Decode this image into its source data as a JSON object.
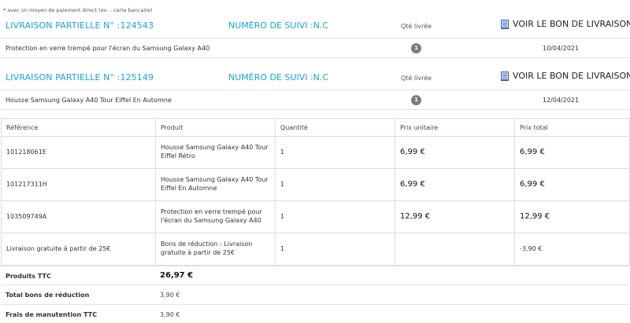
{
  "note": {
    "star": "*",
    "text": "avec un moyen de paiement direct (ex. : carte bancaire)"
  },
  "shipments": [
    {
      "title": "LIVRAISON PARTIELLE N° :124543",
      "tracking": "NUMÉRO DE SUIVI :N.C",
      "qty_header": "Qté livrée",
      "link": "VOIR LE BON DE LIVRAISON",
      "product": "Protection en verre trempé pour l'écran du Samsung Galaxy A40",
      "qty": "1",
      "date": "10/04/2021"
    },
    {
      "title": "LIVRAISON PARTIELLE N° :125149",
      "tracking": "NUMÉRO DE SUIVI :N.C",
      "qty_header": "Qté livrée",
      "link": "VOIR LE BON DE LIVRAISON",
      "product": "Housse Samsung Galaxy A40 Tour Eiffel En Automne",
      "qty": "1",
      "date": "12/04/2021"
    }
  ],
  "table": {
    "headers": [
      "Référence",
      "Produit",
      "Quantité",
      "Prix unitaire",
      "Prix total"
    ],
    "rows": [
      {
        "ref": "101218061E",
        "product": "Housse Samsung Galaxy A40 Tour Eiffel Rétro",
        "qty": "1",
        "unit": "6,99 €",
        "total": "6,99 €"
      },
      {
        "ref": "101217311H",
        "product": "Housse Samsung Galaxy A40 Tour Eiffel En Automne",
        "qty": "1",
        "unit": "6,99 €",
        "total": "6,99 €"
      },
      {
        "ref": "103509749A",
        "product": "Protection en verre trempé pour l'écran du Samsung Galaxy A40",
        "qty": "1",
        "unit": "12,99 €",
        "total": "12,99 €"
      },
      {
        "ref": "Livraison gratuite à partir de 25€",
        "product": "Bons de réduction : Livraison gratuite à partir de 25€",
        "qty": "1",
        "unit": "",
        "total": "-3,90 €"
      }
    ]
  },
  "totals": [
    {
      "label": "Produits TTC",
      "value": "26,97 €"
    },
    {
      "label": "Total bons de réduction",
      "value": "3,90 €"
    },
    {
      "label": "Frais de manutention TTC",
      "value": "3,90 €"
    }
  ],
  "colors": {
    "accent": "#1aa3d6",
    "badge": "#7d7d7d",
    "required_star": "#d9001b",
    "doc_icon": "#3b5bb5"
  },
  "icons": {
    "delivery_link": "document-icon"
  }
}
